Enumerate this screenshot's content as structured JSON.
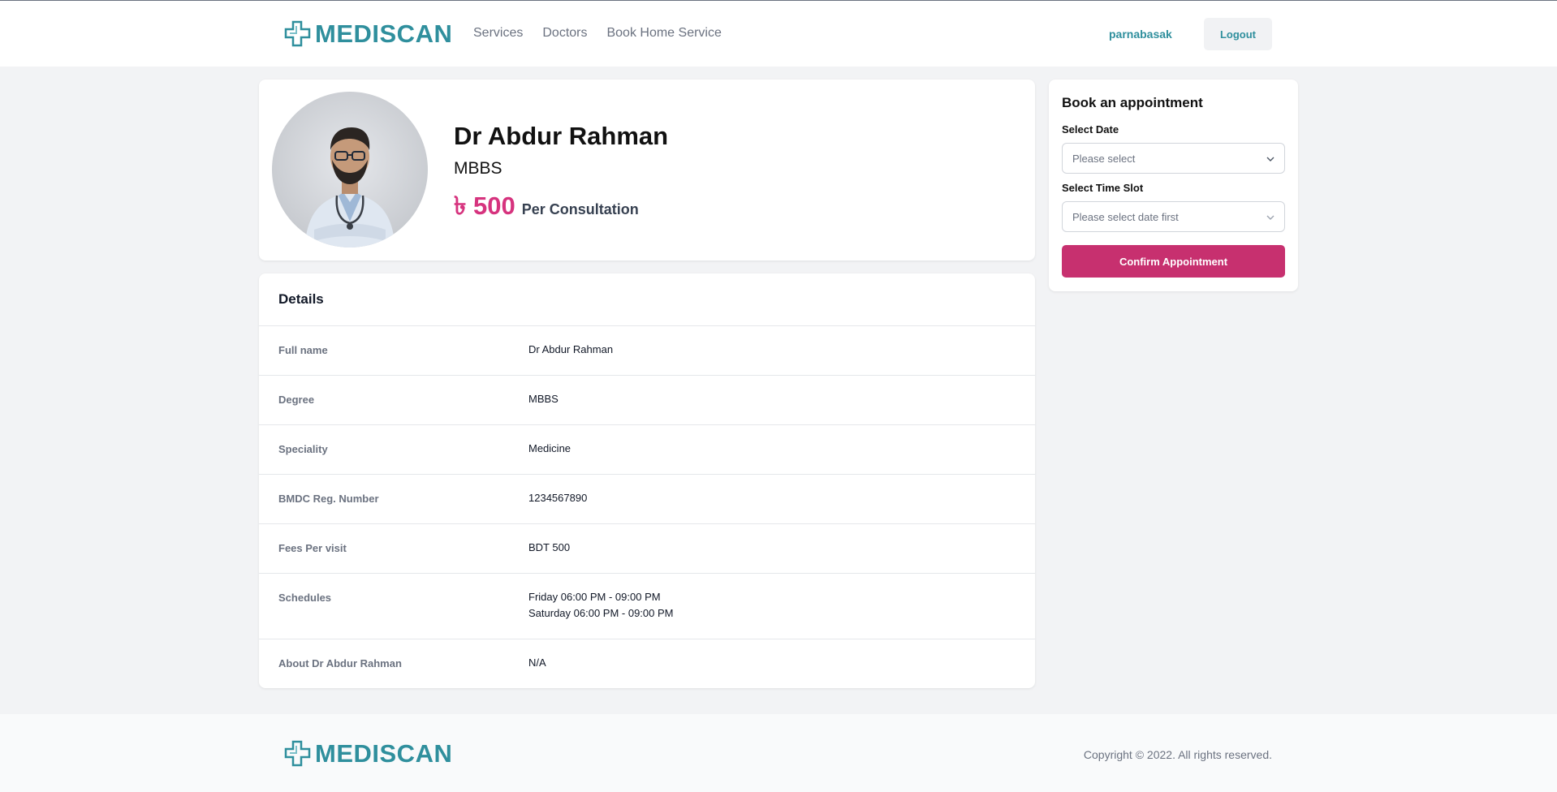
{
  "header": {
    "logo_text": "MEDISCAN",
    "nav": [
      {
        "label": "Services"
      },
      {
        "label": "Doctors"
      },
      {
        "label": "Book Home Service"
      }
    ],
    "username": "parnabasak",
    "logout_label": "Logout"
  },
  "profile": {
    "name": "Dr Abdur Rahman",
    "degree": "MBBS",
    "price": "৳ 500",
    "price_suffix": "Per Consultation"
  },
  "details": {
    "title": "Details",
    "rows": [
      {
        "label": "Full name",
        "value": "Dr Abdur Rahman"
      },
      {
        "label": "Degree",
        "value": "MBBS"
      },
      {
        "label": "Speciality",
        "value": "Medicine"
      },
      {
        "label": "BMDC Reg. Number",
        "value": "1234567890"
      },
      {
        "label": "Fees Per visit",
        "value": "BDT 500"
      },
      {
        "label": "Schedules",
        "value_lines": [
          "Friday 06:00 PM - 09:00 PM",
          "Saturday 06:00 PM - 09:00 PM"
        ]
      },
      {
        "label": "About Dr Abdur Rahman",
        "value": "N/A"
      }
    ]
  },
  "booking": {
    "title": "Book an appointment",
    "date_label": "Select Date",
    "date_placeholder": "Please select",
    "slot_label": "Select Time Slot",
    "slot_placeholder": "Please select date first",
    "confirm_label": "Confirm Appointment"
  },
  "footer": {
    "logo_text": "MEDISCAN",
    "copyright": "Copyright © 2022. All rights reserved."
  },
  "colors": {
    "brand": "#2f8f9d",
    "accent": "#c7306f",
    "price": "#d6337e"
  }
}
